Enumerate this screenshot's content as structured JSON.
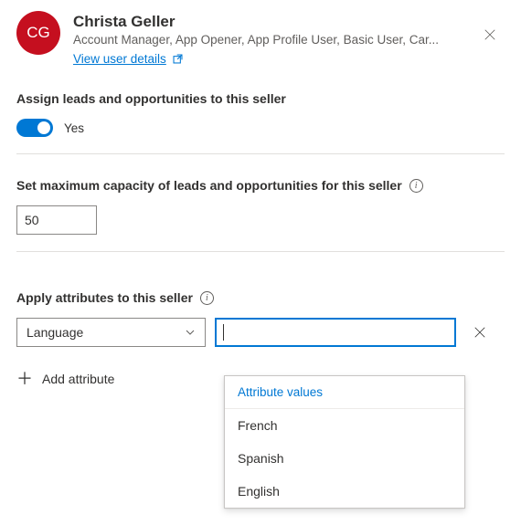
{
  "user": {
    "initials": "CG",
    "name": "Christa Geller",
    "roles": "Account Manager, App Opener, App Profile User, Basic User, Car...",
    "details_link": "View user details"
  },
  "assign": {
    "title": "Assign leads and opportunities to this seller",
    "toggle_label": "Yes"
  },
  "capacity": {
    "title": "Set maximum capacity of leads and opportunities for this seller",
    "value": "50"
  },
  "attributes": {
    "title": "Apply attributes to this seller",
    "select_value": "Language",
    "input_value": "",
    "dropdown_header": "Attribute values",
    "options": [
      "French",
      "Spanish",
      "English"
    ],
    "add_label": "Add attribute"
  }
}
